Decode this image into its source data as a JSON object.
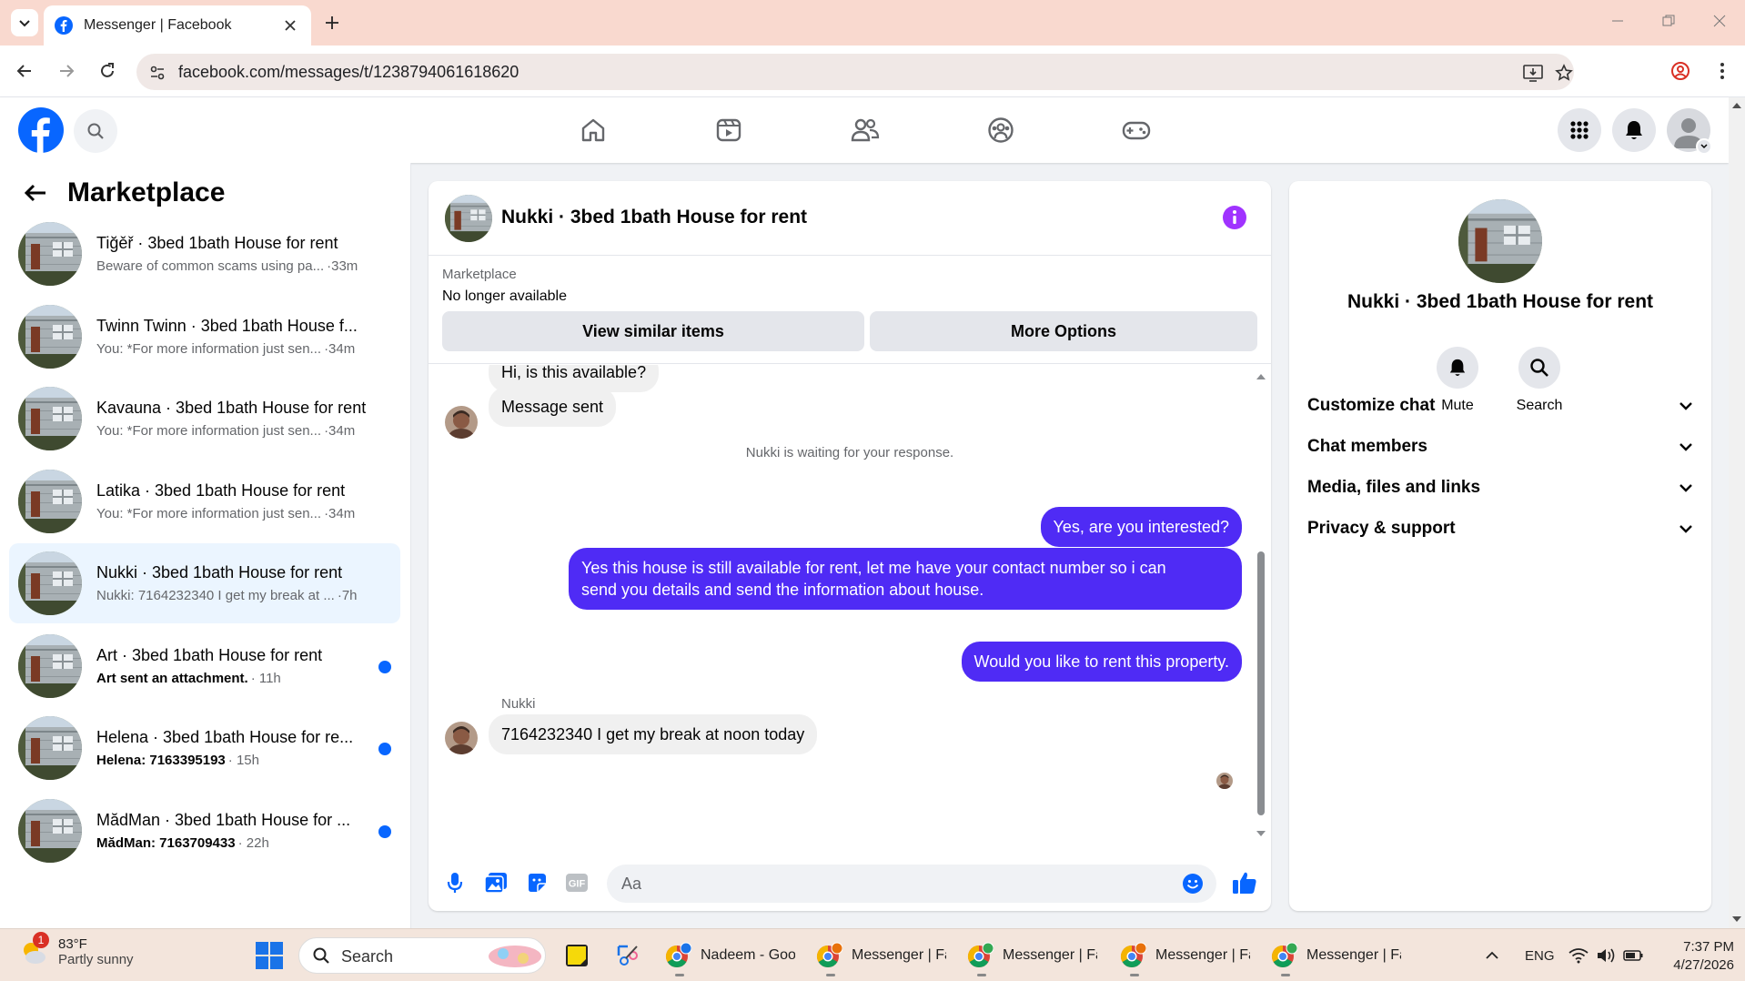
{
  "browser": {
    "tab_title": "Messenger | Facebook",
    "url": "facebook.com/messages/t/1238794061618620"
  },
  "fb": {
    "icons": [
      "home-icon",
      "watch-icon",
      "friends-icon",
      "groups-icon",
      "gaming-icon"
    ]
  },
  "left": {
    "title": "Marketplace",
    "conversations": [
      {
        "name": "Tiğěř · 3bed 1bath House for rent",
        "preview": "Beware of common scams using pa...",
        "time": "·33m",
        "unread": false,
        "active": false
      },
      {
        "name": "Twinn Twinn · 3bed 1bath House f...",
        "preview": "You: *For more information just sen...",
        "time": "·34m",
        "unread": false,
        "active": false
      },
      {
        "name": "Kavauna · 3bed 1bath House for rent",
        "preview": "You: *For more information just sen...",
        "time": "·34m",
        "unread": false,
        "active": false
      },
      {
        "name": "Latika · 3bed 1bath House for rent",
        "preview": "You: *For more information just sen...",
        "time": "·34m",
        "unread": false,
        "active": false
      },
      {
        "name": "Nukki · 3bed 1bath House for rent",
        "preview": "Nukki: 7164232340 I get my break at ...",
        "time": "·7h",
        "unread": false,
        "active": true
      },
      {
        "name": "Art · 3bed 1bath House for rent",
        "preview": "Art sent an attachment.",
        "time": "· 11h",
        "unread": true,
        "active": false
      },
      {
        "name": "Helena · 3bed 1bath House for re...",
        "preview": "Helena: 7163395193",
        "time": "· 15h",
        "unread": true,
        "active": false
      },
      {
        "name": "MădMan · 3bed 1bath House for ...",
        "preview": "MădMan: 7163709433",
        "time": "· 22h",
        "unread": true,
        "active": false
      }
    ]
  },
  "chat": {
    "title": "Nukki · 3bed 1bath House for rent",
    "banner_label": "Marketplace",
    "banner_status": "No longer available",
    "btn_similar": "View similar items",
    "btn_more": "More Options",
    "msg_partial": "Hi, is this available?",
    "msg_sent": "Message sent",
    "waiting_note": "Nukki is waiting for your response.",
    "out1": "Yes, are you interested?",
    "out2_line1": "Yes this house is still available for rent, let me have your contact number so i can",
    "out2_line2": "send you details and send the information about house.",
    "out3": "Would you like to rent this property.",
    "sender": "Nukki",
    "in_last": "7164232340 I get my break at noon today",
    "placeholder": "Aa"
  },
  "right": {
    "name": "Nukki · 3bed 1bath House for rent",
    "mute": "Mute",
    "search": "Search",
    "rows": [
      "Customize chat",
      "Chat members",
      "Media, files and links",
      "Privacy & support"
    ]
  },
  "taskbar": {
    "temp": "83°F",
    "weather": "Partly sunny",
    "weather_badge": "1",
    "search": "Search",
    "apps": [
      "Nadeem - Goo",
      "Messenger | Fa",
      "Messenger | Fa",
      "Messenger | Fa",
      "Messenger | Fa"
    ],
    "lang": "ENG",
    "time": "7:37 PM",
    "date": "4/27/2026"
  },
  "colors": {
    "fb_blue": "#0866ff",
    "bubble_out": "#4f2bf5",
    "info_icon": "#a033ff"
  }
}
